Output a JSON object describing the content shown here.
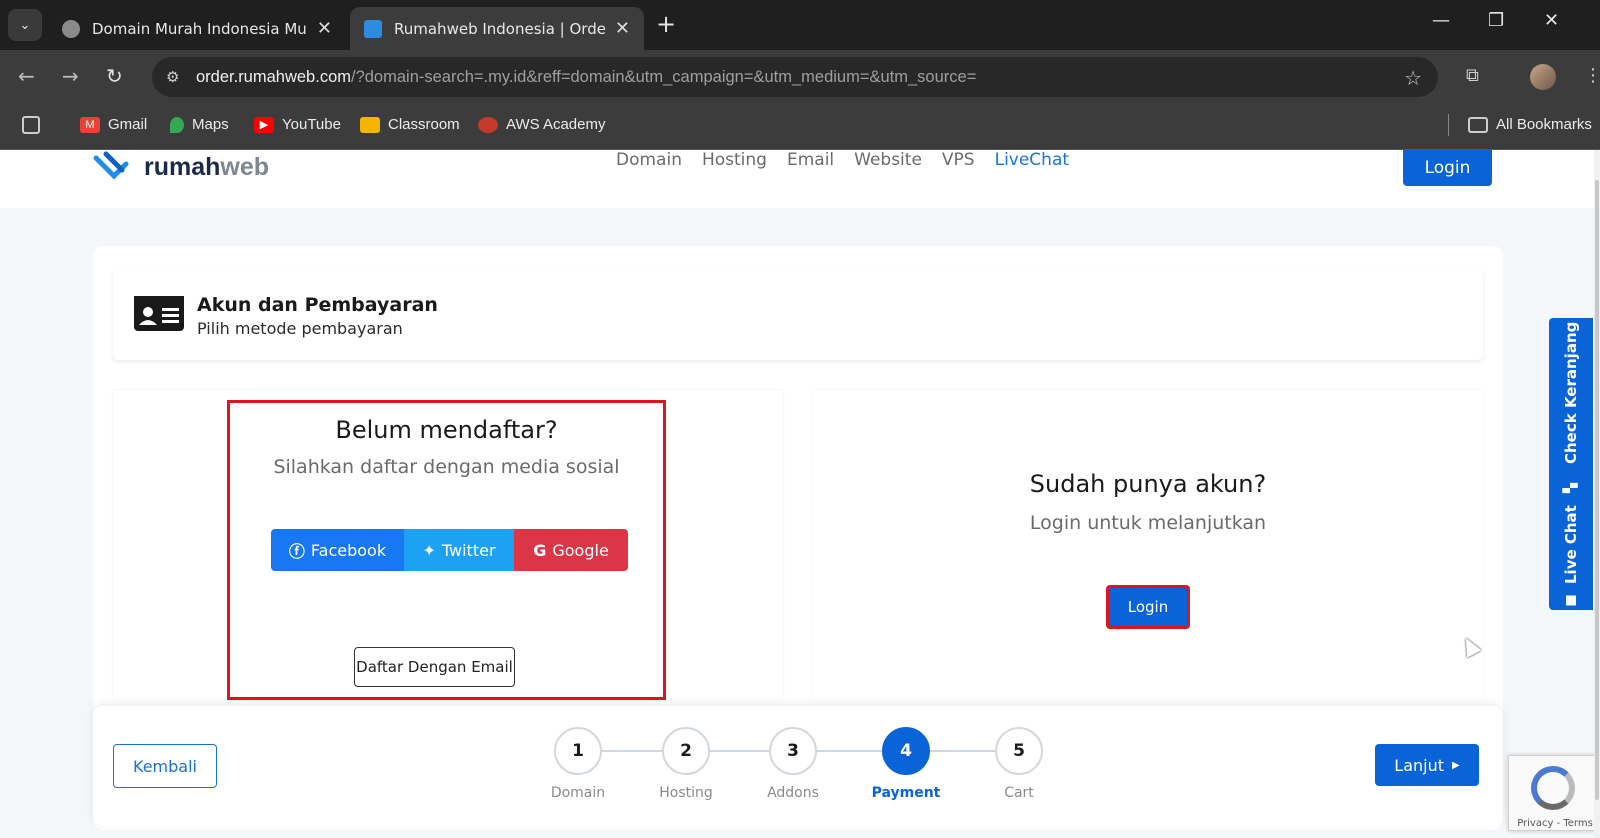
{
  "browser": {
    "tabs": [
      {
        "title": "Domain Murah Indonesia Mula",
        "active": false
      },
      {
        "title": "Rumahweb Indonesia | Order",
        "active": true
      }
    ],
    "url_host": "order.rumahweb.com",
    "url_rest": "/?domain-search=.my.id&reff=domain&utm_campaign=&utm_medium=&utm_source=",
    "bookmarks": [
      "Gmail",
      "Maps",
      "YouTube",
      "Classroom",
      "AWS Academy"
    ],
    "all_bookmarks": "All Bookmarks"
  },
  "site": {
    "logo_part1": "rumah",
    "logo_part2": "web",
    "nav": [
      "Domain",
      "Hosting",
      "Email",
      "Website",
      "VPS",
      "LiveChat"
    ],
    "login_label": "Login"
  },
  "section": {
    "title": "Akun dan Pembayaran",
    "subtitle": "Pilih metode pembayaran"
  },
  "register": {
    "title": "Belum mendaftar?",
    "subtitle": "Silahkan daftar dengan media sosial",
    "facebook": "Facebook",
    "twitter": "Twitter",
    "google": "Google",
    "email_button": "Daftar Dengan Email"
  },
  "account": {
    "title": "Sudah punya akun?",
    "subtitle": "Login untuk melanjutkan",
    "login_button": "Login"
  },
  "footer": {
    "back": "Kembali",
    "next": "Lanjut",
    "steps": [
      {
        "num": "1",
        "label": "Domain"
      },
      {
        "num": "2",
        "label": "Hosting"
      },
      {
        "num": "3",
        "label": "Addons"
      },
      {
        "num": "4",
        "label": "Payment"
      },
      {
        "num": "5",
        "label": "Cart"
      }
    ],
    "active_step": 4
  },
  "side_tab": {
    "check_cart": "Check Keranjang",
    "live_chat": "Live Chat"
  },
  "recaptcha": {
    "text": "Privacy - Terms"
  },
  "colors": {
    "brand_blue": "#0a64d8",
    "highlight_red": "#e0141e",
    "facebook": "#1877f2",
    "twitter": "#1da1f2",
    "google": "#dc3545"
  }
}
